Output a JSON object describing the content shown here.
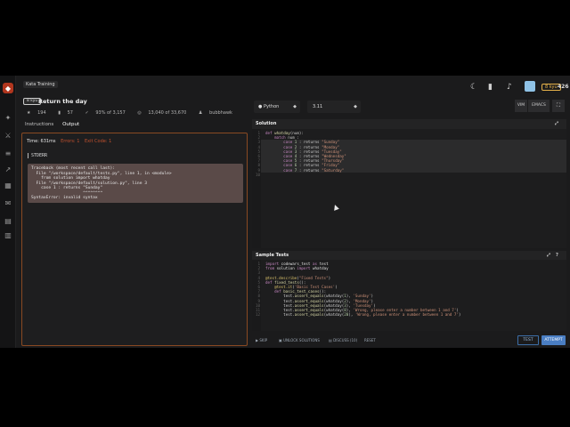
{
  "rail": {
    "icons": [
      "codewars-logo",
      "dojo-icon",
      "practice-icon",
      "train-icon",
      "leaderboard-icon",
      "kumite-icon",
      "discuss-icon",
      "docs-icon",
      "blog-icon"
    ]
  },
  "topbar": {
    "honor": "426",
    "rank_badge": "8 kyu",
    "icons": [
      "moon-icon",
      "bookmark-icon",
      "bell-icon"
    ]
  },
  "kata": {
    "tag": "Kata Training",
    "kyu": "8 kyu",
    "title": "Return the day",
    "stats": {
      "stars": "194",
      "votes": "57",
      "satisfaction": "93% of 3,157",
      "completed": "13,040 of 33,670",
      "author": "bubbhawk"
    }
  },
  "left_tabs": [
    {
      "label": "Instructions"
    },
    {
      "label": "Output"
    }
  ],
  "output": {
    "time": "Time: 631ms",
    "errors": "Errors: 1",
    "exit_code": "Exit Code: 1",
    "stderr_label": "STDERR",
    "traceback": "Traceback (most recent call last):\n  File \"/workspace/default/tests.py\", line 1, in <module>\n    from solution import whatday\n  File \"/workspace/default/solution.py\", line 3\n    case 1 : returns \"Sunday\"\n                     ^^^^^^^^\nSyntaxError: invalid syntax"
  },
  "toolbar": {
    "language": "Python",
    "version": "3.11",
    "vim_label": "VIM",
    "emacs_label": "EMACS"
  },
  "solution": {
    "header": "Solution"
  },
  "tests": {
    "header": "Sample Tests"
  },
  "bottom": {
    "skip": "SKIP",
    "unlock": "UNLOCK SOLUTIONS",
    "discuss": "DISCUSS (10)",
    "reset": "RESET",
    "test": "TEST",
    "attempt": "ATTEMPT"
  },
  "colors": {
    "accent_orange": "#8a4a22",
    "attempt_blue": "#4a7ec3",
    "error_red": "#c0502e"
  }
}
